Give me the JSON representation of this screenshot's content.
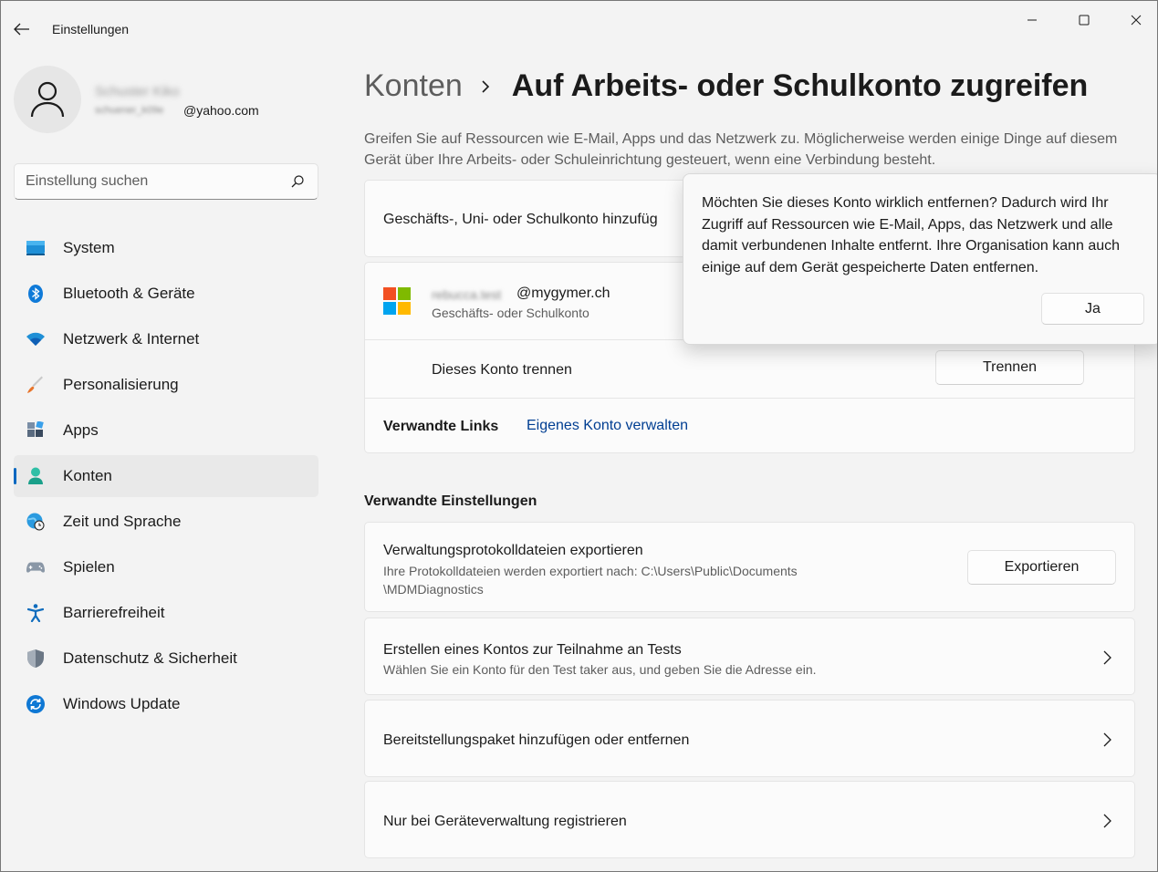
{
  "window": {
    "title": "Einstellungen",
    "controls": {
      "minimize": "—",
      "maximize": "▢",
      "close": "✕"
    }
  },
  "profile": {
    "name_redacted": "Schuster Kiko",
    "email_redacted": "schuener_k09e",
    "email_domain": "@yahoo.com"
  },
  "search": {
    "placeholder": "Einstellung suchen"
  },
  "sidebar": {
    "items": [
      {
        "label": "System",
        "icon": "system-icon"
      },
      {
        "label": "Bluetooth & Geräte",
        "icon": "bluetooth-icon"
      },
      {
        "label": "Netzwerk & Internet",
        "icon": "wifi-icon"
      },
      {
        "label": "Personalisierung",
        "icon": "brush-icon"
      },
      {
        "label": "Apps",
        "icon": "apps-icon"
      },
      {
        "label": "Konten",
        "icon": "account-icon",
        "active": true
      },
      {
        "label": "Zeit und Sprache",
        "icon": "time-language-icon"
      },
      {
        "label": "Spielen",
        "icon": "gamepad-icon"
      },
      {
        "label": "Barrierefreiheit",
        "icon": "accessibility-icon"
      },
      {
        "label": "Datenschutz & Sicherheit",
        "icon": "shield-icon"
      },
      {
        "label": "Windows Update",
        "icon": "update-icon"
      }
    ]
  },
  "breadcrumb": {
    "parent": "Konten",
    "current": "Auf Arbeits- oder Schulkonto zugreifen"
  },
  "description": "Greifen Sie auf Ressourcen wie E-Mail, Apps und das Netzwerk zu. Möglicherweise werden einige Dinge auf diesem Gerät über Ihre Arbeits- oder Schuleinrichtung gesteuert, wenn eine Verbindung besteht.",
  "add_account": {
    "label": "Geschäfts-, Uni- oder Schulkonto hinzufüg"
  },
  "account": {
    "email_redacted": "rebucca.test",
    "email_domain": "@mygymer.ch",
    "type": "Geschäfts- oder Schulkonto",
    "disconnect_label": "Dieses Konto trennen",
    "disconnect_button": "Trennen",
    "related_links_label": "Verwandte Links",
    "manage_link": "Eigenes Konto verwalten"
  },
  "related_settings": {
    "title": "Verwandte Einstellungen",
    "export": {
      "title": "Verwaltungsprotokolldateien exportieren",
      "subtitle_line1": "Ihre Protokolldateien werden exportiert nach: C:\\Users\\Public\\Documents",
      "subtitle_line2": "\\MDMDiagnostics",
      "button": "Exportieren"
    },
    "test_account": {
      "title": "Erstellen eines Kontos zur Teilnahme an Tests",
      "subtitle": "Wählen Sie ein Konto für den Test taker aus, und geben Sie die Adresse ein."
    },
    "provisioning": {
      "title": "Bereitstellungspaket hinzufügen oder entfernen"
    },
    "device_mgmt": {
      "title": "Nur bei Geräteverwaltung registrieren"
    }
  },
  "flyout": {
    "message": "Möchten Sie dieses Konto wirklich entfernen? Dadurch wird Ihr Zugriff auf Ressourcen wie E-Mail, Apps, das Netzwerk und alle damit verbundenen Inhalte entfernt. Ihre Organisation kann auch einige auf dem Gerät gespeicherte Daten entfernen.",
    "confirm_button": "Ja"
  },
  "colors": {
    "accent": "#0067c0",
    "link": "#003e92",
    "ms_red": "#f25022",
    "ms_green": "#7fba00",
    "ms_blue": "#00a4ef",
    "ms_yellow": "#ffb900"
  }
}
